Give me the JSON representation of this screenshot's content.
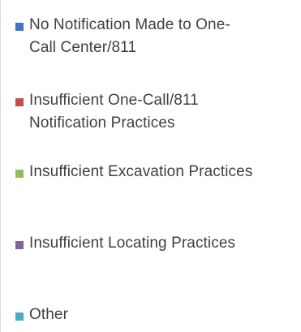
{
  "chart_data": {
    "type": "pie",
    "legend": [
      {
        "name": "No Notification Made to One-Call Center/811",
        "line1": "No Notification Made to One-",
        "line2": "Call Center/811",
        "color": "#4472c4"
      },
      {
        "name": "Insufficient One-Call/811 Notification Practices",
        "line1": "Insufficient One-Call/811",
        "line2": "Notification Practices",
        "color": "#c0504d"
      },
      {
        "name": "Insufficient Excavation Practices",
        "line1": "Insufficient Excavation Practices",
        "line2": "",
        "color": "#9bbb59"
      },
      {
        "name": "Insufficient Locating Practices",
        "line1": "Insufficient Locating Practices",
        "line2": "",
        "color": "#8064a2"
      },
      {
        "name": "Other",
        "line1": "Other",
        "line2": "",
        "color": "#4bacc6"
      }
    ],
    "legend_position": "right"
  }
}
